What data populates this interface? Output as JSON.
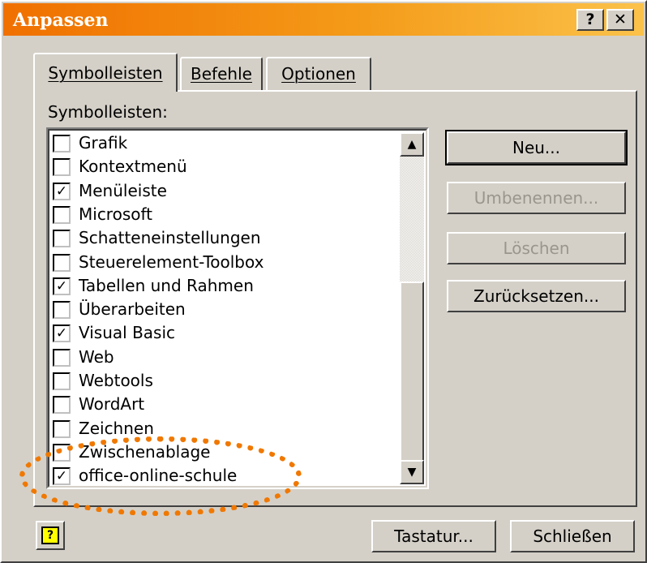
{
  "dialog": {
    "title": "Anpassen",
    "help_button": "?",
    "close_button": "✕"
  },
  "tabs": [
    {
      "label": "Symbolleisten",
      "active": true
    },
    {
      "label": "Befehle",
      "active": false
    },
    {
      "label": "Optionen",
      "active": false
    }
  ],
  "toolbars_label": "Symbolleisten:",
  "toolbars": [
    {
      "label": "Grafik",
      "checked": false
    },
    {
      "label": "Kontextmenü",
      "checked": false
    },
    {
      "label": "Menüleiste",
      "checked": true
    },
    {
      "label": "Microsoft",
      "checked": false
    },
    {
      "label": "Schatteneinstellungen",
      "checked": false
    },
    {
      "label": "Steuerelement-Toolbox",
      "checked": false
    },
    {
      "label": "Tabellen und Rahmen",
      "checked": true
    },
    {
      "label": "Überarbeiten",
      "checked": false
    },
    {
      "label": "Visual Basic",
      "checked": true
    },
    {
      "label": "Web",
      "checked": false
    },
    {
      "label": "Webtools",
      "checked": false
    },
    {
      "label": "WordArt",
      "checked": false
    },
    {
      "label": "Zeichnen",
      "checked": false
    },
    {
      "label": "Zwischenablage",
      "checked": false
    },
    {
      "label": "office-online-schule",
      "checked": true
    }
  ],
  "scrollbar": {
    "up_arrow": "▲",
    "down_arrow": "▼"
  },
  "buttons": {
    "new": "Neu...",
    "rename": "Umbenennen...",
    "delete": "Löschen",
    "reset": "Zurücksetzen...",
    "keyboard": "Tastatur...",
    "close": "Schließen"
  },
  "check_mark": "✓",
  "help_icon_glyph": "?",
  "colors": {
    "titlebar_start": "#f07000",
    "titlebar_end": "#fbc24a",
    "face": "#d4d0c8",
    "highlight_ring": "#f07800"
  }
}
